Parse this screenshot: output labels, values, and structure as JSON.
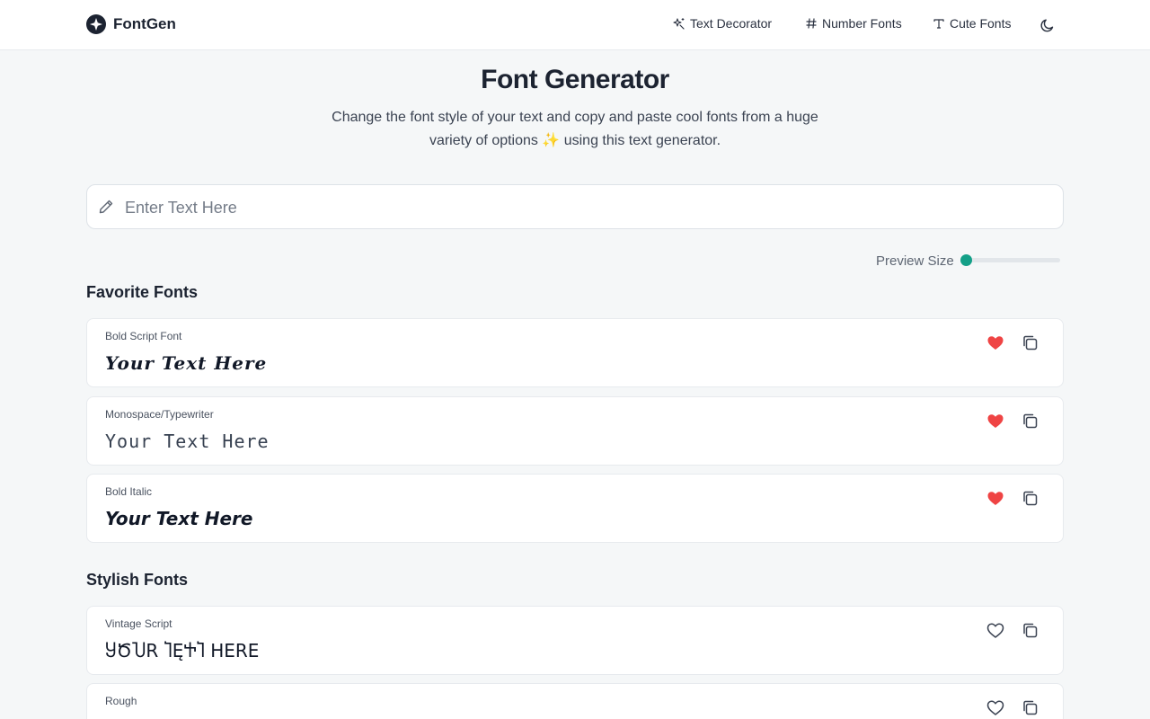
{
  "header": {
    "brand": "FontGen",
    "nav": [
      {
        "label": "Text Decorator",
        "icon": "sparkle-wand-icon"
      },
      {
        "label": "Number Fonts",
        "icon": "hash-icon"
      },
      {
        "label": "Cute Fonts",
        "icon": "type-icon"
      }
    ],
    "theme_toggle_icon": "moon-icon"
  },
  "hero": {
    "title": "Font Generator",
    "subtitle": "Change the font style of your text and copy and paste cool fonts from a huge variety of options ✨ using this text generator."
  },
  "input": {
    "placeholder": "Enter Text Here",
    "value": ""
  },
  "preview_size": {
    "label": "Preview Size",
    "value_fraction": 0
  },
  "sections": [
    {
      "heading": "Favorite Fonts",
      "fonts": [
        {
          "name": "Bold Script Font",
          "preview": "Your Text Here",
          "favorited": true
        },
        {
          "name": "Monospace/Typewriter",
          "preview": "Your Text Here",
          "favorited": true
        },
        {
          "name": "Bold Italic",
          "preview": "Your Text Here",
          "favorited": true
        }
      ]
    },
    {
      "heading": "Stylish Fonts",
      "fonts": [
        {
          "name": "Vintage Script",
          "preview": "ႸԾႮR ႨĘႵႨ HERE",
          "favorited": false
        },
        {
          "name": "Rough",
          "preview": "",
          "favorited": false
        }
      ]
    }
  ],
  "colors": {
    "accent": "#14a088",
    "heart_active": "#ef4444",
    "background": "#f5f7f8"
  }
}
